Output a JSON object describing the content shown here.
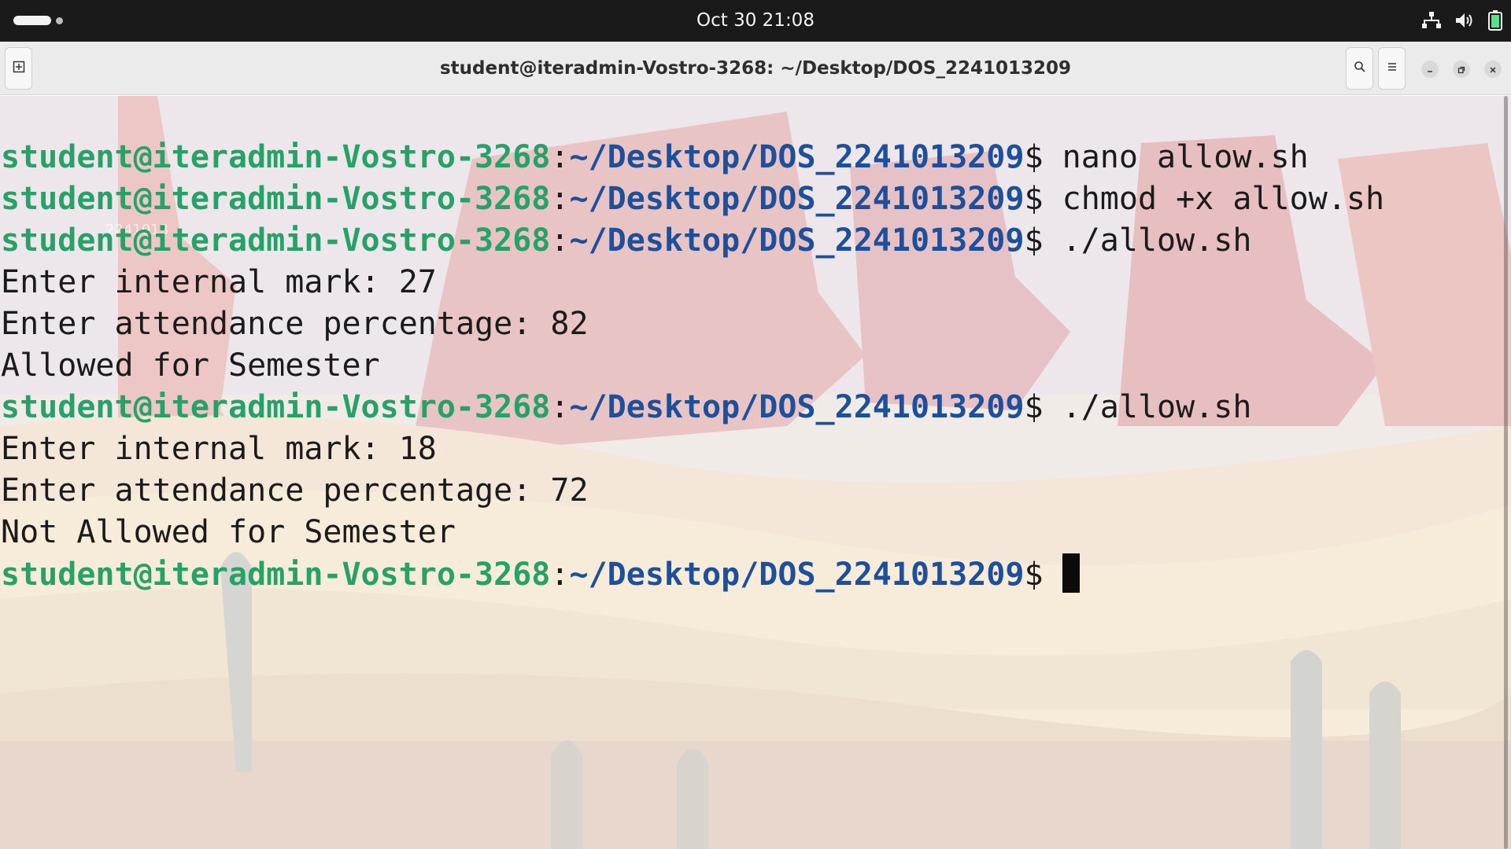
{
  "topbar": {
    "clock": "Oct 30  21:08",
    "icons": [
      "network-icon",
      "volume-icon",
      "battery-icon"
    ]
  },
  "window": {
    "title": "student@iteradmin-Vostro-3268: ~/Desktop/DOS_2241013209",
    "buttons": [
      "new-tab-icon",
      "search-icon",
      "menu-icon",
      "minimize-icon",
      "maximize-icon",
      "close-icon"
    ]
  },
  "terminal": {
    "prompt_user": "student@iteradmin-Vostro-3268",
    "prompt_colon": ":",
    "prompt_path": "~/Desktop/DOS_2241013209",
    "prompt_symbol": "$ ",
    "lines": [
      {
        "type": "prompt",
        "command": "nano allow.sh"
      },
      {
        "type": "prompt",
        "command": "chmod +x allow.sh"
      },
      {
        "type": "prompt",
        "command": "./allow.sh"
      },
      {
        "type": "output",
        "text": "Enter internal mark: 27"
      },
      {
        "type": "output",
        "text": "Enter attendance percentage: 82"
      },
      {
        "type": "output",
        "text": "Allowed for Semester"
      },
      {
        "type": "prompt",
        "command": "./allow.sh"
      },
      {
        "type": "output",
        "text": "Enter internal mark: 18"
      },
      {
        "type": "output",
        "text": "Enter attendance percentage: 72"
      },
      {
        "type": "output",
        "text": "Not Allowed for Semester"
      },
      {
        "type": "prompt",
        "command": ""
      }
    ],
    "ghost_label": "2241013"
  },
  "colors": {
    "prompt_user": "#26a269",
    "prompt_path": "#1d4f9a",
    "topbar_bg": "#1a1a1a"
  }
}
